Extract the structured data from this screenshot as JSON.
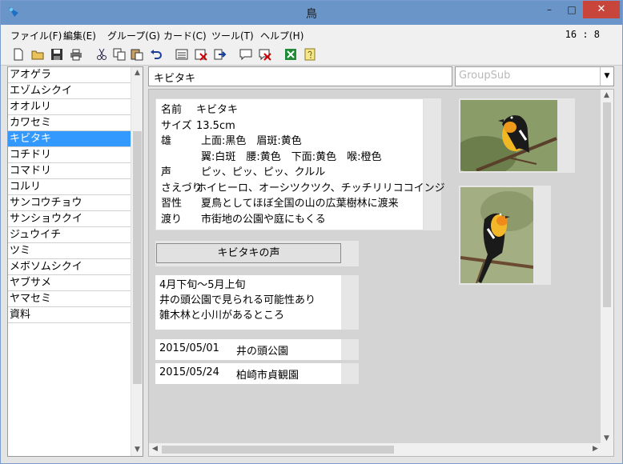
{
  "window": {
    "title": "鳥",
    "min": "–",
    "max": "□",
    "close": "✕"
  },
  "menu": [
    "ファイル(F)",
    "編集(E)",
    "グループ(G)",
    "カード(C)",
    "ツール(T)",
    "ヘルプ(H)"
  ],
  "clock": "16 : 8",
  "toolbar": [
    "new-file-icon",
    "open-folder-icon",
    "save-icon",
    "print-icon",
    "cut-icon",
    "copy-icon",
    "paste-icon",
    "undo-icon",
    "card-list-icon",
    "delete-card-icon",
    "export-icon",
    "comment-icon",
    "delete-comment-icon",
    "excel-icon",
    "help-note-icon"
  ],
  "sidebar": {
    "items": [
      "アオゲラ",
      "エゾムシクイ",
      "オオルリ",
      "カワセミ",
      "キビタキ",
      "コチドリ",
      "コマドリ",
      "コルリ",
      "サンコウチョウ",
      "サンショウクイ",
      "ジュウイチ",
      "ツミ",
      "メボソムシクイ",
      "ヤブサメ",
      "ヤマセミ",
      "資料"
    ],
    "selected_index": 4
  },
  "name_field": {
    "value": "キビタキ"
  },
  "group_select": {
    "value": "GroupSub"
  },
  "info": {
    "rows": [
      {
        "label": "名前",
        "value": "キビタキ"
      },
      {
        "label": "サイズ",
        "value": "13.5cm"
      },
      {
        "label": "雄",
        "value": "上面:黒色　眉斑:黄色"
      },
      {
        "label": "",
        "value": "翼:白斑　腰:黄色　下面:黄色　喉:橙色"
      },
      {
        "label": "声",
        "value": "ピッ、ピッ、ピッ、クルル"
      },
      {
        "label": "さえづり",
        "value": "ホイヒーロ、オーシツクツク、チッチリリココインジ"
      },
      {
        "label": "習性",
        "value": "夏鳥としてほぼ全国の山の広葉樹林に渡来"
      },
      {
        "label": "渡り",
        "value": "市街地の公園や庭にもくる"
      }
    ]
  },
  "voice_button": "キビタキの声",
  "notes": [
    "4月下旬〜5月上旬",
    "井の頭公園で見られる可能性あり",
    "雑木林と小川があるところ"
  ],
  "observations": [
    {
      "date": "2015/05/01",
      "place": "井の頭公園"
    },
    {
      "date": "2015/05/24",
      "place": "柏崎市貞観園"
    }
  ],
  "colors": {
    "selected": "#3399ff",
    "titlebar": "#6a95c8",
    "close": "#c7453a"
  }
}
